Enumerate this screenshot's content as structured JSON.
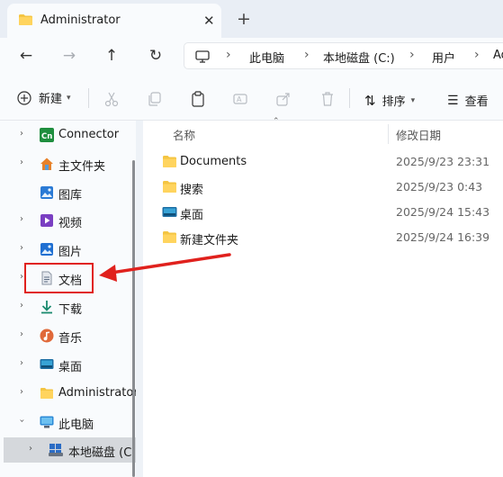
{
  "tab": {
    "title": "Administrator",
    "close": "✕",
    "new_tab": "+"
  },
  "nav": {
    "back": "←",
    "forward": "→",
    "up": "↑",
    "refresh": "↻"
  },
  "breadcrumb": [
    "此电脑",
    "本地磁盘 (C:)",
    "用户",
    "Ad"
  ],
  "breadcrumb_sep": "›",
  "toolbar": {
    "new_label": "新建",
    "icons": [
      "cut-icon",
      "copy-icon",
      "paste-icon",
      "rename-icon",
      "share-icon",
      "delete-icon"
    ],
    "sort_label": "排序",
    "view_label": "查看"
  },
  "sidebar": {
    "items": [
      {
        "label": "Connector",
        "icon": "connector-app-icon",
        "expandable": true
      },
      {
        "label": "主文件夹",
        "icon": "home-icon",
        "expandable": true
      },
      {
        "label": "图库",
        "icon": "gallery-icon",
        "expandable": false
      },
      {
        "label": "视频",
        "icon": "videos-icon",
        "expandable": true
      },
      {
        "label": "图片",
        "icon": "pictures-icon",
        "expandable": true
      },
      {
        "label": "文档",
        "icon": "documents-icon",
        "expandable": true
      },
      {
        "label": "下载",
        "icon": "downloads-icon",
        "expandable": true
      },
      {
        "label": "音乐",
        "icon": "music-icon",
        "expandable": true
      },
      {
        "label": "桌面",
        "icon": "desktop-icon",
        "expandable": true
      },
      {
        "label": "Administrator",
        "icon": "folder-icon",
        "expandable": true
      },
      {
        "label": "此电脑",
        "icon": "this-pc-icon",
        "expanded": true
      },
      {
        "label": "本地磁盘 (C:)",
        "icon": "drive-icon",
        "selected": true
      }
    ]
  },
  "content": {
    "columns": {
      "name": "名称",
      "modified": "修改日期"
    },
    "rows": [
      {
        "name": "Documents",
        "date": "2025/9/23 23:31",
        "icon": "folder-icon"
      },
      {
        "name": "搜索",
        "date": "2025/9/23 0:43",
        "icon": "folder-icon"
      },
      {
        "name": "桌面",
        "date": "2025/9/24 15:43",
        "icon": "desktop-icon"
      },
      {
        "name": "新建文件夹",
        "date": "2025/9/24 16:39",
        "icon": "folder-icon"
      }
    ]
  },
  "colors": {
    "annotation": "#e0211d",
    "folder": "#f4c542",
    "accent": "#0067c0"
  }
}
